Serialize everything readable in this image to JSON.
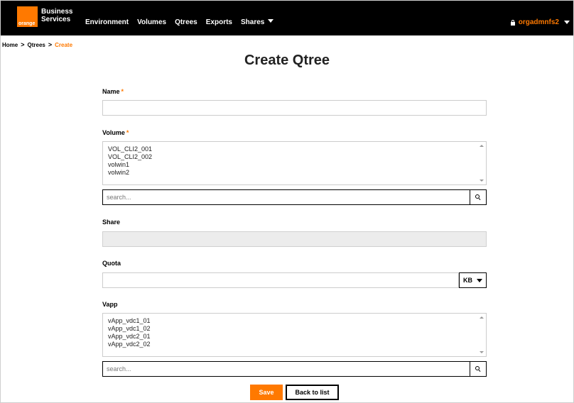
{
  "header": {
    "logo_word": "orange",
    "brand_line1": "Business",
    "brand_line2": "Services",
    "nav": [
      {
        "label": "Environment"
      },
      {
        "label": "Volumes"
      },
      {
        "label": "Qtrees"
      },
      {
        "label": "Exports"
      },
      {
        "label": "Shares"
      }
    ],
    "user": "orgadmnfs2"
  },
  "breadcrumb": {
    "items": [
      "Home",
      "Qtrees",
      "Create"
    ],
    "separator": ">"
  },
  "page_title": "Create Qtree",
  "form": {
    "name_label": "Name",
    "name_value": "",
    "required_marker": "*",
    "volume_label": "Volume",
    "volume_options": [
      "VOL_CLI2_001",
      "VOL_CLI2_002",
      "volwin1",
      "volwin2"
    ],
    "volume_search_placeholder": "search...",
    "share_label": "Share",
    "share_value": "",
    "quota_label": "Quota",
    "quota_value": "",
    "quota_unit": "KB",
    "vapp_label": "Vapp",
    "vapp_options": [
      "vApp_vdc1_01",
      "vApp_vdc1_02",
      "vApp_vdc2_01",
      "vApp_vdc2_02"
    ],
    "vapp_search_placeholder": "search..."
  },
  "buttons": {
    "save": "Save",
    "back": "Back to list"
  },
  "colors": {
    "accent": "#ff7900",
    "header_bg": "#000000"
  },
  "icons": [
    "lock-icon",
    "search-icon",
    "chevron-down-icon"
  ]
}
